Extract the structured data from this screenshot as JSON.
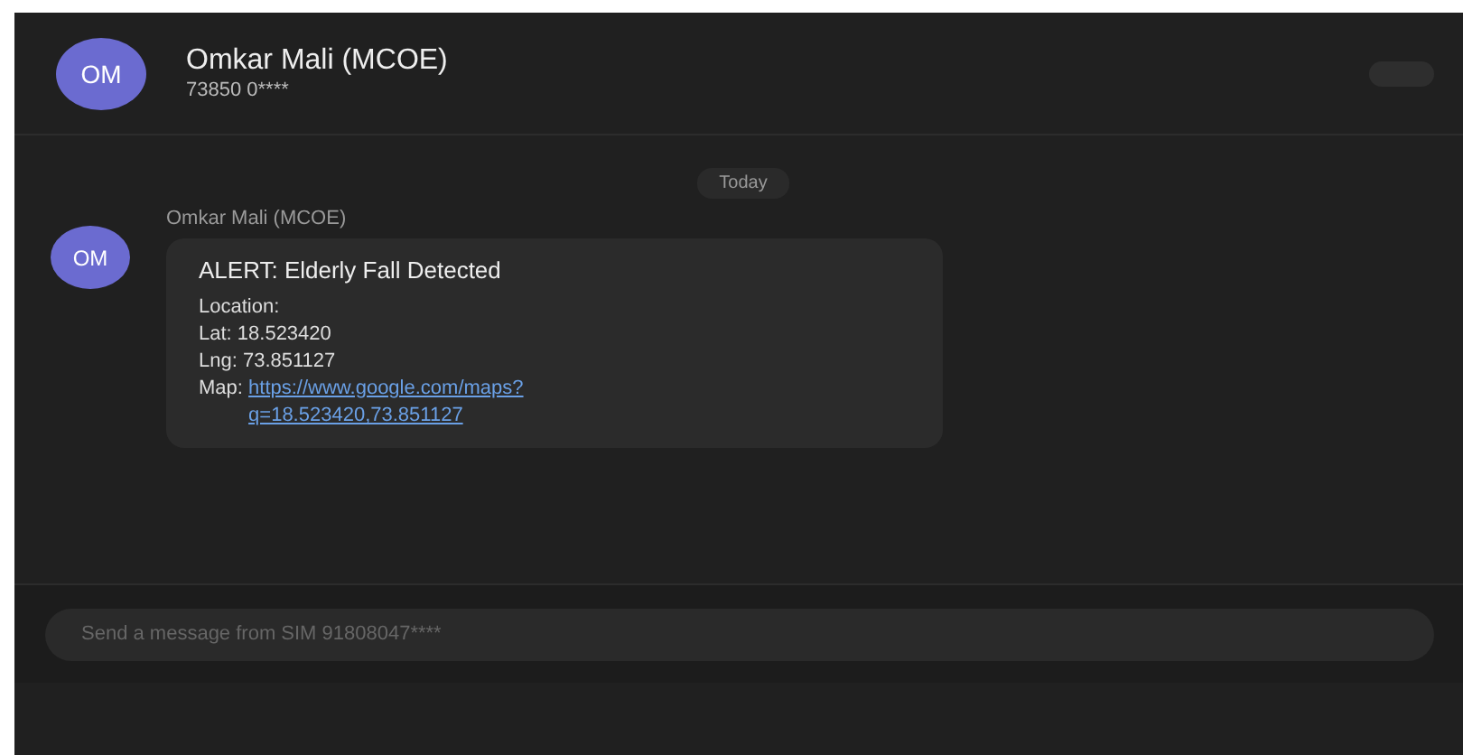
{
  "header": {
    "avatar": "OM",
    "name": "Omkar Mali (MCOE)",
    "number": "73850 0****"
  },
  "date_separator": "Today",
  "messages": [
    {
      "avatar": "OM",
      "sender": "Omkar Mali (MCOE)",
      "title": "ALERT: Elderly Fall Detected",
      "lines": [
        "Location:",
        "Lat: 18.523420",
        "Lng: 73.851127"
      ],
      "link_label": "Map:",
      "link": "https://www.google.com/maps?q=18.523420,73.851127"
    }
  ],
  "composer": {
    "placeholder": "Send a message from SIM 91808047****"
  }
}
